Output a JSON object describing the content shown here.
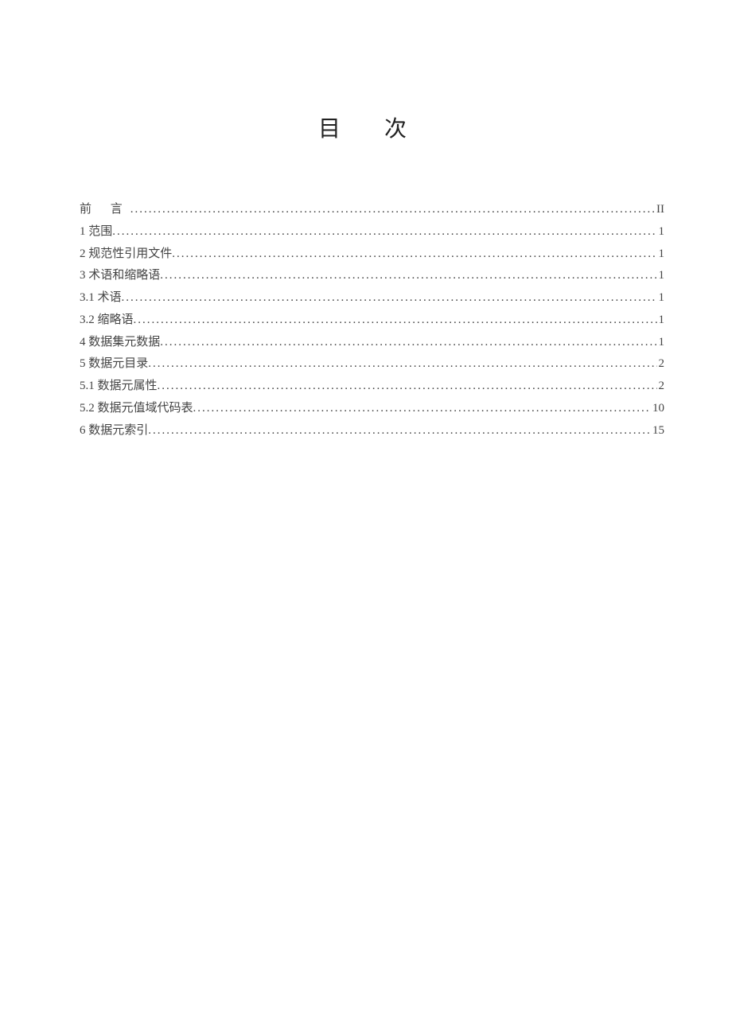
{
  "title": "目 次",
  "toc": [
    {
      "label": "前  言",
      "page": "II",
      "preface": true
    },
    {
      "label": "1 范围",
      "page": "1"
    },
    {
      "label": "2 规范性引用文件",
      "page": "1"
    },
    {
      "label": "3 术语和缩略语",
      "page": "1"
    },
    {
      "label": "3.1 术语",
      "page": "1"
    },
    {
      "label": "3.2 缩略语",
      "page": "1"
    },
    {
      "label": "4 数据集元数据",
      "page": "1"
    },
    {
      "label": "5 数据元目录",
      "page": "2"
    },
    {
      "label": "5.1 数据元属性",
      "page": "2"
    },
    {
      "label": "5.2 数据元值域代码表",
      "page": "10"
    },
    {
      "label": "6 数据元索引",
      "page": "15"
    }
  ]
}
